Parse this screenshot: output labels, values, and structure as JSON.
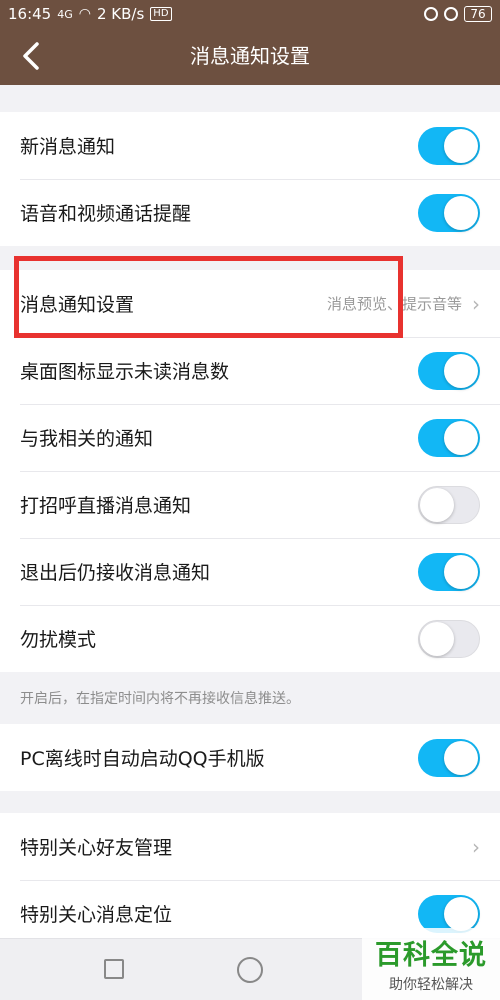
{
  "status_bar": {
    "time": "16:45",
    "signal": "4G",
    "speed": "2 KB/s",
    "hd": "HD",
    "battery": "76"
  },
  "header": {
    "title": "消息通知设置",
    "back_icon": "back-arrow-icon"
  },
  "group1": [
    {
      "label": "新消息通知",
      "toggle": "on"
    },
    {
      "label": "语音和视频通话提醒",
      "toggle": "on"
    }
  ],
  "group2": {
    "detail_row": {
      "label": "消息通知设置",
      "sub": "消息预览、提示音等"
    },
    "rows": [
      {
        "label": "桌面图标显示未读消息数",
        "toggle": "on"
      },
      {
        "label": "与我相关的通知",
        "toggle": "on"
      },
      {
        "label": "打招呼直播消息通知",
        "toggle": "off"
      },
      {
        "label": "退出后仍接收消息通知",
        "toggle": "on"
      },
      {
        "label": "勿扰模式",
        "toggle": "off"
      }
    ]
  },
  "dnd_description": "开启后，在指定时间内将不再接收信息推送。",
  "group3": [
    {
      "label": "PC离线时自动启动QQ手机版",
      "toggle": "on"
    }
  ],
  "group4": {
    "rows": [
      {
        "label": "特别关心好友管理"
      },
      {
        "label": "特别关心消息定位",
        "toggle": "on"
      }
    ]
  },
  "watermark": {
    "main": "百科全说",
    "sub": "助你轻松解决"
  },
  "colors": {
    "header_bg": "#6d5040",
    "toggle_on": "#12b7f5",
    "highlight": "#e8322f"
  }
}
